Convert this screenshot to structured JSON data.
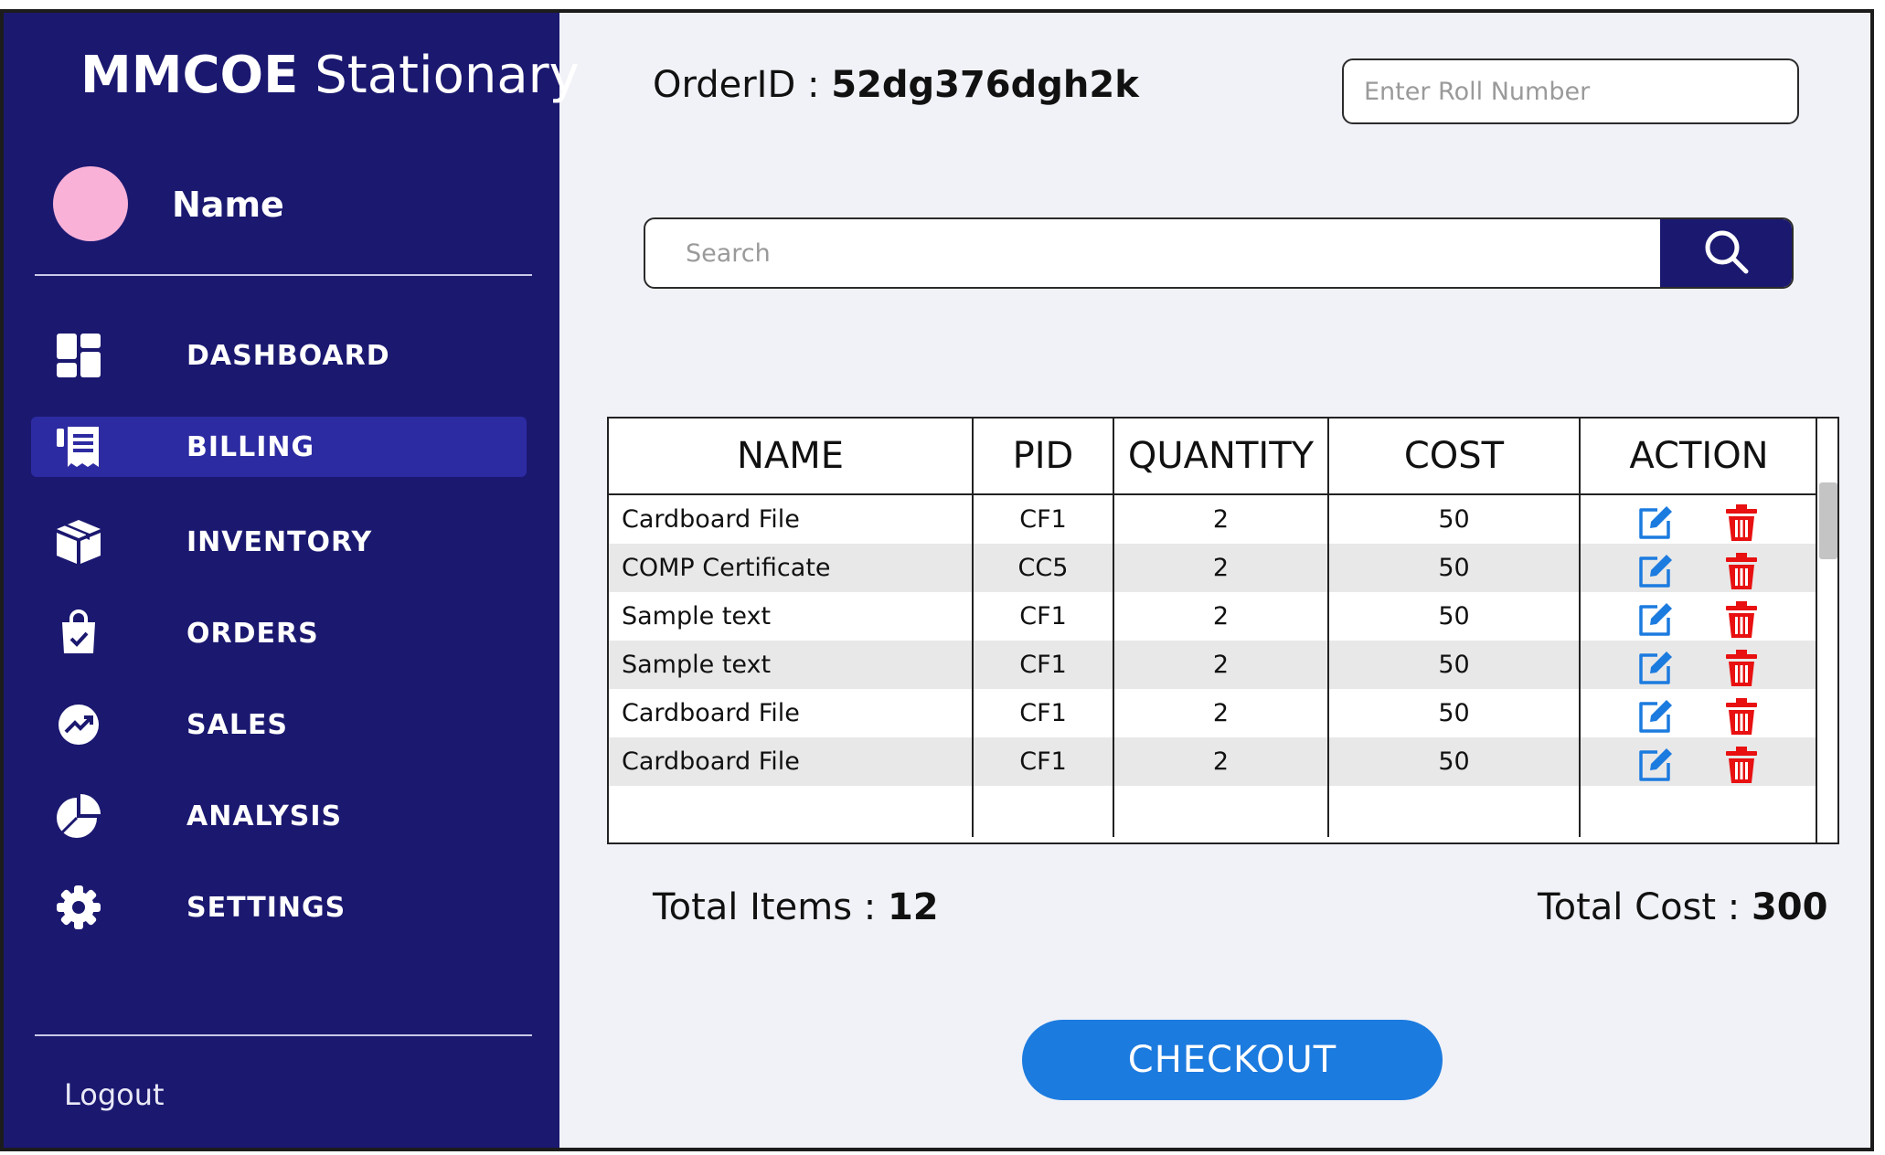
{
  "app": {
    "title_bold": "MMCOE",
    "title_rest": "Stationary"
  },
  "user": {
    "name": "Name"
  },
  "sidebar": {
    "items": [
      {
        "label": "DASHBOARD",
        "icon": "dashboard-icon"
      },
      {
        "label": "BILLING",
        "icon": "billing-icon",
        "active": true
      },
      {
        "label": "INVENTORY",
        "icon": "inventory-box-icon"
      },
      {
        "label": "ORDERS",
        "icon": "shopping-bag-icon"
      },
      {
        "label": "SALES",
        "icon": "trending-up-icon"
      },
      {
        "label": "ANALYSIS",
        "icon": "pie-chart-icon"
      },
      {
        "label": "SETTINGS",
        "icon": "gear-icon"
      }
    ],
    "logout_label": "Logout"
  },
  "order": {
    "label": "OrderID : ",
    "id": "52dg376dgh2k"
  },
  "roll": {
    "placeholder": "Enter Roll Number"
  },
  "search": {
    "placeholder": "Search",
    "icon": "search-icon"
  },
  "table": {
    "columns": [
      "NAME",
      "PID",
      "QUANTITY",
      "COST",
      "ACTION"
    ],
    "rows": [
      {
        "name": "Cardboard File",
        "pid": "CF1",
        "quantity": "2",
        "cost": "50"
      },
      {
        "name": "COMP Certificate",
        "pid": "CC5",
        "quantity": "2",
        "cost": "50"
      },
      {
        "name": "Sample text",
        "pid": "CF1",
        "quantity": "2",
        "cost": "50"
      },
      {
        "name": "Sample text",
        "pid": "CF1",
        "quantity": "2",
        "cost": "50"
      },
      {
        "name": "Cardboard File",
        "pid": "CF1",
        "quantity": "2",
        "cost": "50"
      },
      {
        "name": "Cardboard File",
        "pid": "CF1",
        "quantity": "2",
        "cost": "50"
      }
    ],
    "action_icons": {
      "edit": "edit-icon",
      "delete": "trash-icon"
    }
  },
  "summary": {
    "items_label": "Total Items : ",
    "items_value": "12",
    "cost_label": "Total Cost : ",
    "cost_value": "300"
  },
  "checkout": {
    "label": "CHECKOUT"
  },
  "colors": {
    "sidebar_bg": "#1b1870",
    "active_item": "#2d2ba2",
    "avatar": "#f9b1d8",
    "checkout": "#1c7bdf",
    "edit_icon": "#1c7bdf",
    "delete_icon": "#e81010",
    "main_bg": "#f1f2f7"
  }
}
